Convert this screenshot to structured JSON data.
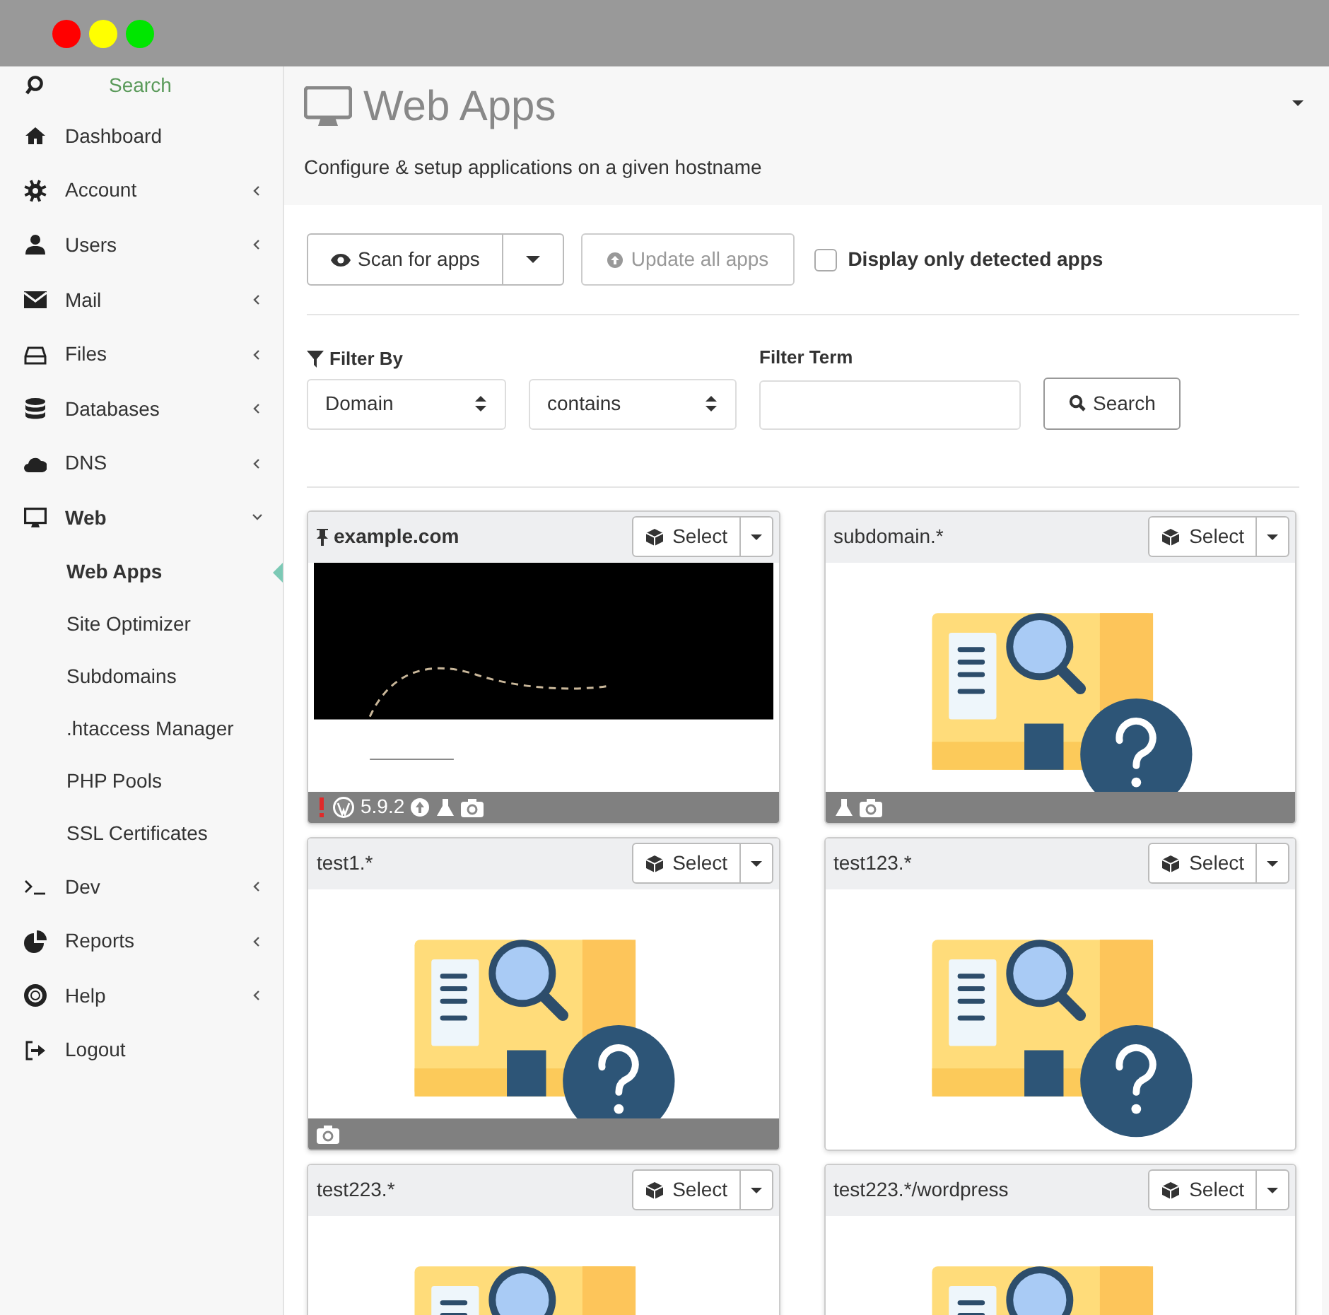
{
  "window_controls": [
    {
      "color": "#ff0000"
    },
    {
      "color": "#ffff00"
    },
    {
      "color": "#00e600"
    }
  ],
  "sidebar": {
    "search": {
      "placeholder": "Search"
    },
    "items": [
      {
        "label": "Dashboard"
      },
      {
        "label": "Account",
        "expanded": false
      },
      {
        "label": "Users",
        "expanded": false
      },
      {
        "label": "Mail",
        "expanded": false
      },
      {
        "label": "Files",
        "expanded": false
      },
      {
        "label": "Databases",
        "expanded": false
      },
      {
        "label": "DNS",
        "expanded": false
      },
      {
        "label": "Web",
        "expanded": true,
        "children": [
          {
            "label": "Web Apps",
            "selected": true
          },
          {
            "label": "Site Optimizer",
            "selected": false
          },
          {
            "label": "Subdomains",
            "selected": false
          },
          {
            "label": ".htaccess Manager",
            "selected": false
          },
          {
            "label": "PHP Pools",
            "selected": false
          },
          {
            "label": "SSL Certificates",
            "selected": false
          }
        ]
      },
      {
        "label": "Dev",
        "expanded": false
      },
      {
        "label": "Reports",
        "expanded": false
      },
      {
        "label": "Help",
        "expanded": false
      },
      {
        "label": "Logout"
      }
    ]
  },
  "header": {
    "title": "Web Apps",
    "subtitle": "Configure & setup applications on a given hostname"
  },
  "toolbar": {
    "scan_button": "Scan for apps",
    "update_button": {
      "label": "Update all apps",
      "disabled": true
    },
    "detected_only": {
      "label": "Display only detected apps",
      "checked": false
    }
  },
  "filter": {
    "label": "Filter By",
    "field_select": "Domain",
    "operator_select": "contains",
    "term_label": "Filter Term",
    "search_button": "Search"
  },
  "apps": [
    {
      "domain": "example.com",
      "pinned": true,
      "preview": {
        "kind": "screenshot"
      },
      "select_button": "Select",
      "footer": [
        {
          "kind": "error"
        },
        {
          "kind": "wordpress"
        },
        {
          "kind": "version",
          "text": "5.9.2"
        },
        {
          "kind": "upgrade"
        },
        {
          "kind": "flask"
        },
        {
          "kind": "camera"
        }
      ]
    },
    {
      "domain": "subdomain.*",
      "pinned": false,
      "preview": {
        "kind": "pending"
      },
      "select_button": "Select",
      "footer": [
        {
          "kind": "flask"
        },
        {
          "kind": "camera"
        }
      ]
    },
    {
      "domain": "test1.*",
      "pinned": false,
      "preview": {
        "kind": "pending"
      },
      "select_button": "Select",
      "footer": [
        {
          "kind": "camera"
        }
      ]
    },
    {
      "domain": "test123.*",
      "pinned": false,
      "preview": {
        "kind": "pending"
      },
      "select_button": "Select"
    },
    {
      "domain": "test223.*",
      "pinned": false,
      "preview": {
        "kind": "pending"
      },
      "select_button": "Select"
    },
    {
      "domain": "test223.*/wordpress",
      "pinned": false,
      "preview": {
        "kind": "pending"
      },
      "select_button": "Select"
    }
  ]
}
